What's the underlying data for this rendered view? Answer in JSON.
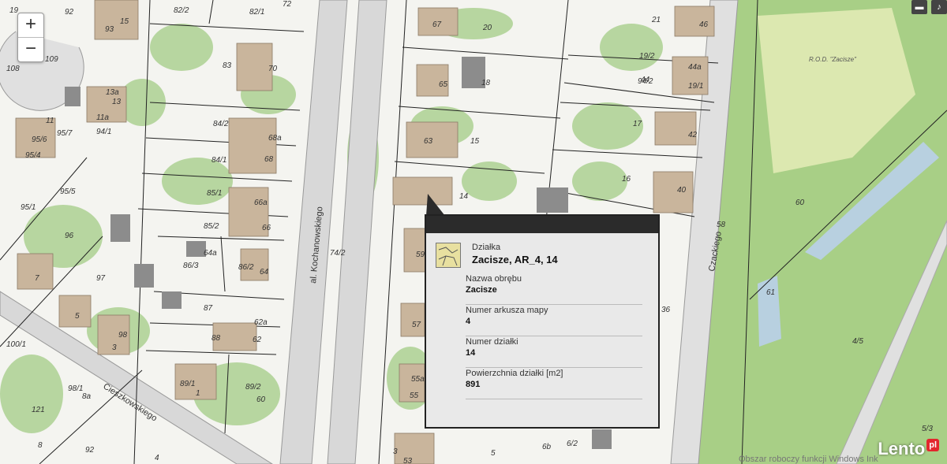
{
  "map": {
    "streets": [
      {
        "name": "al. Kochanowskiego"
      },
      {
        "name": "Czackiego"
      },
      {
        "name": "Cieszkowskiego"
      }
    ],
    "area_label": "R.O.D.\n\"Zacisze\"",
    "parcel_labels": [
      "19",
      "92",
      "82/2",
      "82/1",
      "72",
      "67",
      "20",
      "21",
      "46",
      "93",
      "15",
      "109",
      "108",
      "83",
      "70",
      "65",
      "18",
      "19/2",
      "44a",
      "44",
      "19/1",
      "94/2",
      "13a",
      "13",
      "11a",
      "11",
      "95/6",
      "95/7",
      "94/1",
      "95/4",
      "84/2",
      "68a",
      "84/1",
      "68",
      "63",
      "15",
      "17",
      "42",
      "16",
      "40",
      "95/5",
      "95/1",
      "85/1",
      "66a",
      "85/2",
      "66",
      "14",
      "60",
      "58",
      "96",
      "64a",
      "86/3",
      "86/2",
      "64",
      "59",
      "97",
      "74/2",
      "7",
      "5",
      "98",
      "3",
      "87",
      "62a",
      "88",
      "62",
      "57",
      "36",
      "61",
      "4/5",
      "100/1",
      "98/1",
      "8a",
      "89/1",
      "1",
      "89/2",
      "60",
      "55a",
      "55",
      "121",
      "8",
      "92",
      "4",
      "3",
      "53",
      "5",
      "6b",
      "6/2",
      "5/3"
    ],
    "zoom_in": "+",
    "zoom_out": "−",
    "watermark": "Obszar roboczy funkcji Windows Ink",
    "brand": "Lento",
    "brand_suffix": "pl"
  },
  "popup": {
    "type_label": "Działka",
    "title": "Zacisze, AR_4, 14",
    "fields": [
      {
        "label": "Nazwa obrębu",
        "value": "Zacisze"
      },
      {
        "label": "Numer arkusza mapy",
        "value": "4"
      },
      {
        "label": "Numer działki",
        "value": "14"
      },
      {
        "label": "Powierzchnia działki [m2]",
        "value": "891"
      }
    ]
  },
  "colors": {
    "vegetation": "#b8d8a0",
    "building": "#c8b49a",
    "building_gray": "#8a8a8a",
    "park": "#9cc87a"
  }
}
